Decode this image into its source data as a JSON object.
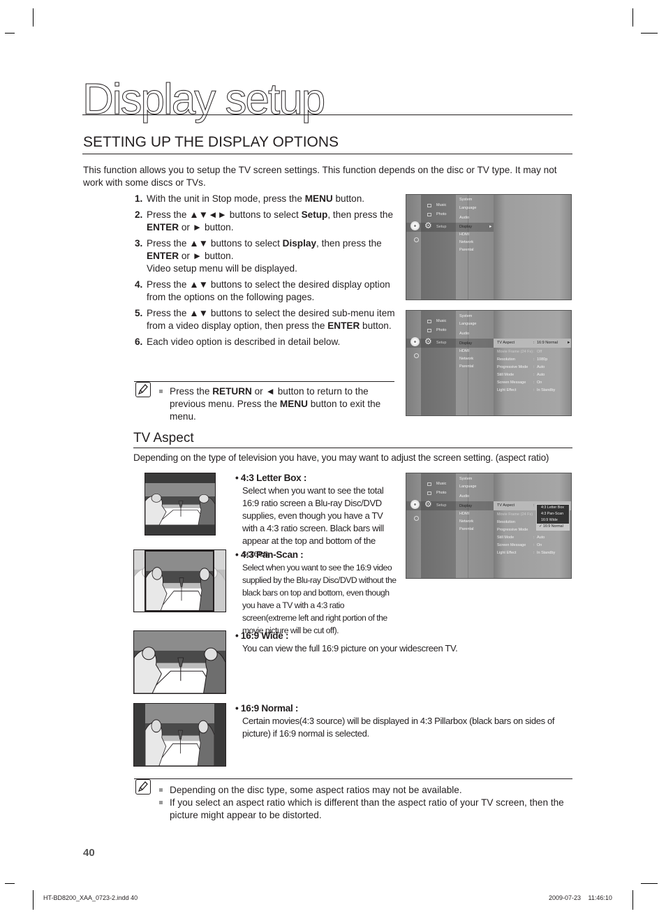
{
  "page": {
    "title": "Display setup",
    "section_title": "SETTING UP THE DISPLAY OPTIONS",
    "intro": "This function allows you to setup the TV screen settings. This function depends on the disc or TV type. It may not work with some discs or TVs."
  },
  "steps": [
    {
      "num": "1.",
      "parts": [
        [
          "t",
          "With the unit in Stop mode, press the "
        ],
        [
          "b",
          "MENU"
        ],
        [
          "t",
          " button."
        ]
      ]
    },
    {
      "num": "2.",
      "parts": [
        [
          "t",
          "Press the ▲▼◄► buttons to select "
        ],
        [
          "b",
          "Setup"
        ],
        [
          "t",
          ", then press the "
        ],
        [
          "b",
          "ENTER"
        ],
        [
          "t",
          " or ► button."
        ]
      ]
    },
    {
      "num": "3.",
      "parts": [
        [
          "t",
          "Press the ▲▼ buttons to select "
        ],
        [
          "b",
          "Display"
        ],
        [
          "t",
          ", then press the "
        ],
        [
          "b",
          "ENTER"
        ],
        [
          "t",
          " or ► button."
        ],
        [
          "br",
          ""
        ],
        [
          "t",
          "Video setup menu will be displayed."
        ]
      ]
    },
    {
      "num": "4.",
      "parts": [
        [
          "t",
          "Press the ▲▼ buttons to select the desired display option from the options on the following pages."
        ]
      ]
    },
    {
      "num": "5.",
      "parts": [
        [
          "t",
          "Press the ▲▼ buttons to select the desired sub-menu item from a video display option, then press the "
        ],
        [
          "b",
          "ENTER"
        ],
        [
          "t",
          " button."
        ]
      ]
    },
    {
      "num": "6.",
      "parts": [
        [
          "t",
          "Each video option is described in detail below."
        ]
      ]
    }
  ],
  "note1": {
    "icon": "note-pencil-icon",
    "parts": [
      [
        "t",
        "Press the "
      ],
      [
        "b",
        "RETURN"
      ],
      [
        "t",
        " or ◄ button to return to the previous menu. Press the "
      ],
      [
        "b",
        "MENU"
      ],
      [
        "t",
        " button to exit the menu."
      ]
    ]
  },
  "osd": {
    "media_items": [
      "Music",
      "Photo",
      "Setup"
    ],
    "setup_items": [
      "System",
      "Language",
      "Audio",
      "Display",
      "HDMI",
      "Network",
      "Parental"
    ],
    "display_options": [
      {
        "label": "TV Aspect",
        "value": "16:9 Normal"
      },
      {
        "label": "Movie Frame (24 Fs)",
        "value": "Off"
      },
      {
        "label": "Resolution",
        "value": "1080p"
      },
      {
        "label": "Progressive Mode",
        "value": "Auto"
      },
      {
        "label": "Still Mode",
        "value": "Auto"
      },
      {
        "label": "Screen Message",
        "value": "On"
      },
      {
        "label": "Light Effect",
        "value": "In Standby"
      }
    ],
    "aspect_dropdown": [
      "4:3 Letter Box",
      "4:3 Pan-Scan",
      "16:9 Wide",
      "16:9 Normal"
    ],
    "aspect_selected": "16:9 Normal",
    "check_mark": "✓",
    "arrow": "►"
  },
  "tv_aspect": {
    "title": "TV Aspect",
    "desc": "Depending on the type of television you have, you may want to adjust the screen setting. (aspect ratio)",
    "options": [
      {
        "head": "• 4:3 Letter Box :",
        "desc": "Select when you want to see the total 16:9 ratio screen a Blu-ray Disc/DVD supplies, even though you have a TV with a 4:3 ratio screen. Black bars will appear at the top and bottom of the screen."
      },
      {
        "head": "• 4:3 Pan-Scan :",
        "desc": "Select when you want to see the 16:9 video supplied by the Blu-ray Disc/DVD without the black bars on top and bottom, even though you have a TV with a 4:3 ratio screen(extreme left and right portion of the movie picture will be cut off)."
      },
      {
        "head": "• 16:9 Wide :",
        "desc": "You can view the full 16:9 picture on your widescreen TV."
      },
      {
        "head": "• 16:9 Normal :",
        "desc": "Certain movies(4:3 source) will be displayed in 4:3 Pillarbox (black bars on sides of picture) if 16:9 normal is selected."
      }
    ]
  },
  "note2": {
    "icon": "note-pencil-icon",
    "items": [
      "Depending on the disc type, some aspect ratios may not be available.",
      "If you select an aspect ratio which is different than the aspect ratio of your TV screen, then the picture might appear to be distorted."
    ]
  },
  "footer": {
    "page_number": "40",
    "file": "HT-BD8200_XAA_0723-2.indd   40",
    "date": "2009-07-23 11:46:10"
  }
}
